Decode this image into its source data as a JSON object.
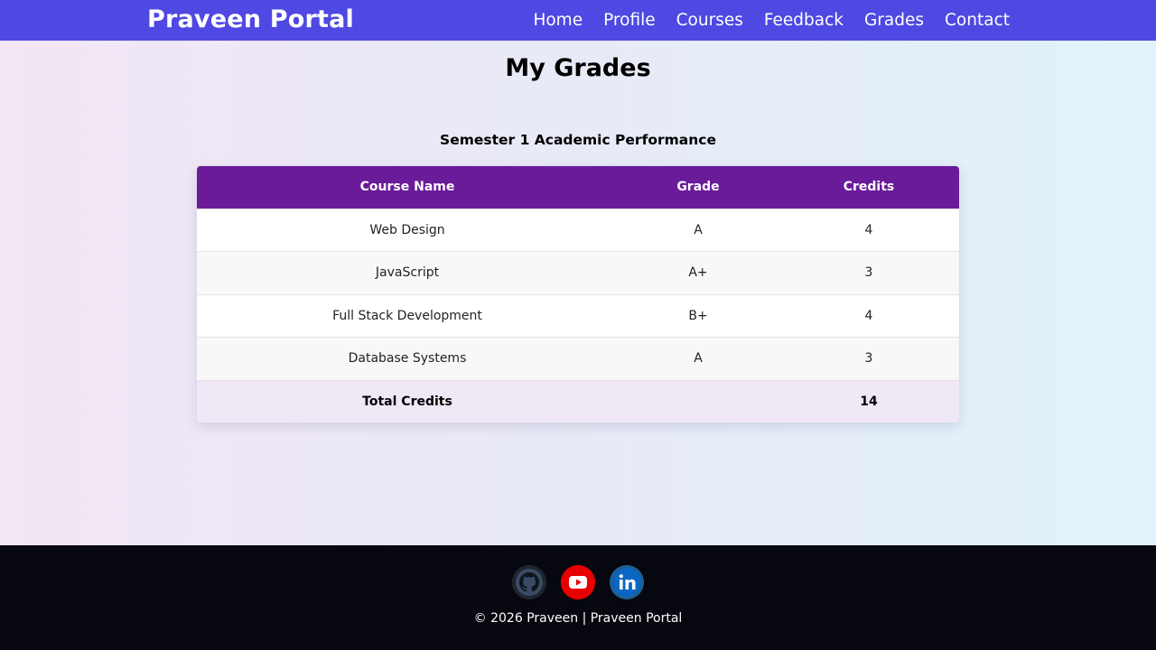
{
  "navbar": {
    "brand": "Praveen Portal",
    "links": [
      "Home",
      "Profile",
      "Courses",
      "Feedback",
      "Grades",
      "Contact"
    ]
  },
  "page": {
    "title": "My Grades",
    "caption": "Semester 1 Academic Performance"
  },
  "table": {
    "headers": [
      "Course Name",
      "Grade",
      "Credits"
    ],
    "rows": [
      {
        "course": "Web Design",
        "grade": "A",
        "credits": "4"
      },
      {
        "course": "JavaScript",
        "grade": "A+",
        "credits": "3"
      },
      {
        "course": "Full Stack Development",
        "grade": "B+",
        "credits": "4"
      },
      {
        "course": "Database Systems",
        "grade": "A",
        "credits": "3"
      }
    ],
    "total_label": "Total Credits",
    "total_value": "14"
  },
  "footer": {
    "social": [
      {
        "icon": "github-icon",
        "color": "#2b3340"
      },
      {
        "icon": "youtube-icon",
        "color": "#ff0000"
      },
      {
        "icon": "linkedin-icon",
        "color": "#0a66c2"
      }
    ],
    "copyright": "© 2026 Praveen | Praveen Portal"
  },
  "colors": {
    "navbar": "#4f48e2",
    "table_header": "#6a1b9a",
    "total_row": "#f1e8f6",
    "footer": "#070710"
  }
}
